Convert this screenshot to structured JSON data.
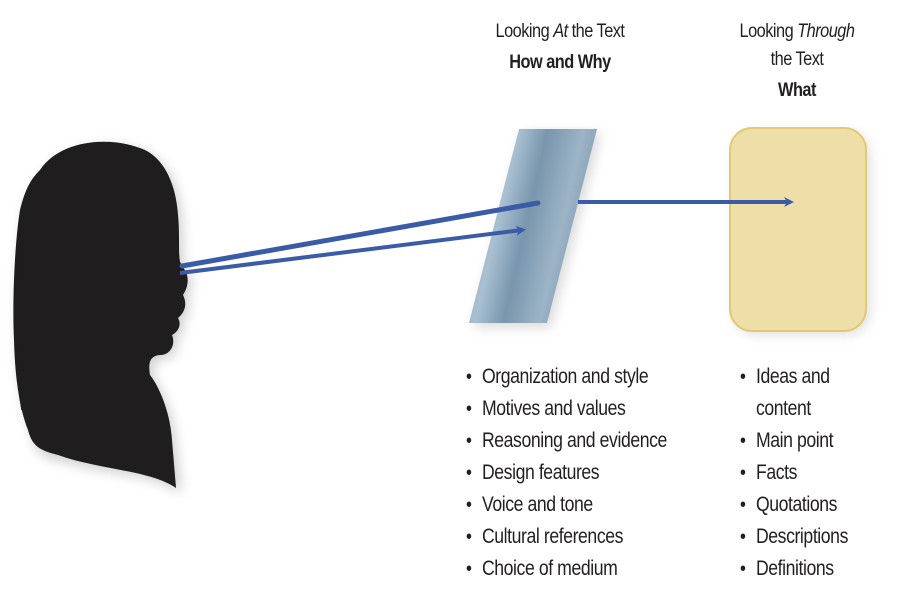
{
  "diagram": {
    "left_column": {
      "heading_prefix": "Looking ",
      "heading_emphasis": "At",
      "heading_suffix": " the Text",
      "subheading": "How and Why",
      "items": [
        "Organization and style",
        "Motives and values",
        "Reasoning and evidence",
        "Design features",
        "Voice and tone",
        "Cultural references",
        "Choice of medium"
      ]
    },
    "right_column": {
      "heading_prefix": "Looking ",
      "heading_emphasis": "Through",
      "heading_suffix": "the Text",
      "subheading": "What",
      "items": [
        "Ideas and",
        "content",
        "Main point",
        "Facts",
        "Quotations",
        "Descriptions",
        "Definitions"
      ]
    },
    "figures": {
      "viewer": "silhouette-head-profile",
      "lens": "glass-panel",
      "content": "text-box"
    },
    "colors": {
      "arrow": "#3a5ba6",
      "panel": "#7f9db4",
      "box_fill": "#eedfa8",
      "box_border": "#e2c974",
      "silhouette": "#1f1d1e",
      "text": "#231f20"
    }
  }
}
